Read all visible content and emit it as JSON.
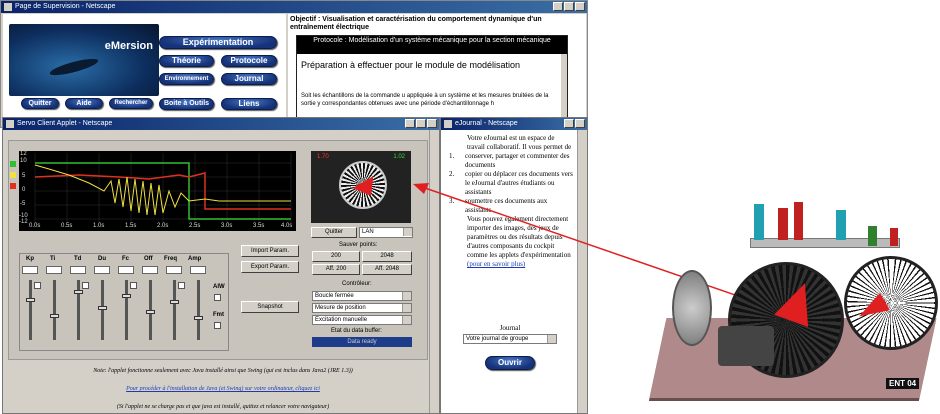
{
  "supervision_window": {
    "title": "Page de Supervision - Netscape",
    "brand": "eMersion",
    "nav": {
      "experimentation": "Expérimentation",
      "theorie": "Théorie",
      "protocole": "Protocole",
      "environnement": "Environnement",
      "journal": "Journal",
      "quitter": "Quitter",
      "aide": "Aide",
      "rechercher": "Rechercher",
      "boite_outils": "Boite à Outils",
      "liens": "Liens"
    },
    "objective": "Objectif : Visualisation et caractérisation du comportement dynamique d'un entraînement électrique",
    "protocol_header": "Protocole : Modélisation d'un système mécanique pour la section mécanique",
    "prep_heading": "Préparation à effectuer pour le module de modélisation",
    "prep_text": "Soit les échantillons de la commande u appliquée à un système et les mesures bruitées de la sortie y correspondantes obtenues avec une période d'échantillonnage h"
  },
  "applet_window": {
    "title": "Servo Client Applet - Netscape",
    "plot_y_ticks": [
      "12",
      "10",
      "5",
      "0",
      "-5",
      "-10",
      "-12"
    ],
    "plot_x_ticks": [
      "0.0s",
      "0.5s",
      "1.0s",
      "1.5s",
      "2.0s",
      "2.5s",
      "3.0s",
      "3.5s",
      "4.0s"
    ],
    "video_left_label": "1.70",
    "video_right_label": "1.02",
    "quit_label": "Quitter",
    "network_select": "LAN",
    "save_points_label": "Sauver points:",
    "save_200": "200",
    "save_2048": "2048",
    "aff_200": "Aff. 200",
    "aff_2048": "Aff. 2048",
    "import_param": "Import Param.",
    "export_param": "Export Param.",
    "snapshot": "Snapshot",
    "slider_labels": [
      "Kp",
      "Ti",
      "Td",
      "Du",
      "Fc",
      "Off",
      "Freq",
      "Amp"
    ],
    "checkbox_labels": [
      "AIW",
      "Fmt"
    ],
    "controller_label": "Contrôleur:",
    "controller_options": [
      "Boucle fermée",
      "Mesure de position",
      "Excitation manuelle"
    ],
    "buffer_label": "Etat du data buffer:",
    "buffer_status": "Data ready",
    "note": "Note: l'applet fonctionne seulement avec Java installé ainsi que Swing (qui est inclus dans Java2 (JRE 1.3))",
    "install_link": "Pour procéder à l'installation de Java (et Swing) sur votre ordinateur, cliquez ici",
    "reload_note": "(Si l'applet ne se charge pas et que java est installé, quittez et relancer votre navigateur)"
  },
  "ejournal_window": {
    "title": "eJournal - Netscape",
    "intro": "Votre eJournal est un espace de travail collaboratif. Il vous permet de",
    "list": [
      "conserver, partager et commenter des documents",
      "copier ou déplacer ces documents vers le eJournal d'autres étudiants ou assistants",
      "soumettre ces documents aux assistants"
    ],
    "list_numbers": [
      "1.",
      "2.",
      "3."
    ],
    "body": "Vous pouvez également directement importer des images, des jeux de paramètres ou des résultats depuis d'autres composants du cockpit comme les applets d'expérimentation",
    "more_link": "(pour en savoir plus)",
    "journal_label": "Journal",
    "journal_select": "Votre journal de groupe",
    "open_button": "Ouvrir"
  },
  "device_photo": {
    "tag": "ENT 04"
  },
  "colors": {
    "titlebar": "#0a246a",
    "pill_button": "#1d3c8a",
    "arrow": "#e02020",
    "plot_bg": "#000000",
    "series_red": "#e03020",
    "series_green": "#30c030",
    "series_yellow": "#f0e040"
  }
}
